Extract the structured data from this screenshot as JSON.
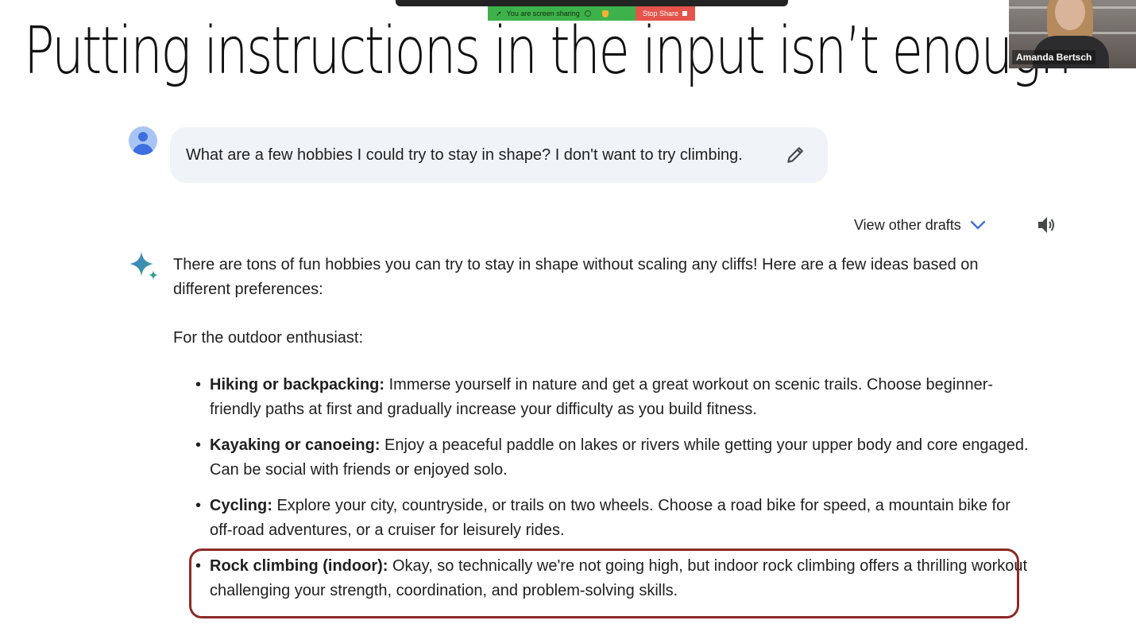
{
  "zoom": {
    "sharing_label": "You are screen sharing",
    "stop_label": "Stop Share",
    "participant_name": "Amanda Bertsch"
  },
  "slide": {
    "title": "Putting instructions in the input isn’t enough"
  },
  "chat": {
    "prompt": "What are a few hobbies I could try to stay in shape? I don't want to try climbing.",
    "view_drafts_label": "View other drafts",
    "intro": "There are tons of fun hobbies you can try to stay in shape without scaling any cliffs! Here are a few ideas based on different preferences:",
    "section_heading": "For the outdoor enthusiast:",
    "items": [
      {
        "title": "Hiking or backpacking:",
        "text": " Immerse yourself in nature and get a great workout on scenic trails. Choose beginner-friendly paths at first and gradually increase your difficulty as you build fitness."
      },
      {
        "title": "Kayaking or canoeing:",
        "text": " Enjoy a peaceful paddle on lakes or rivers while getting your upper body and core engaged. Can be social with friends or enjoyed solo."
      },
      {
        "title": "Cycling:",
        "text": " Explore your city, countryside, or trails on two wheels. Choose a road bike for speed, a mountain bike for off-road adventures, or a cruiser for leisurely rides."
      },
      {
        "title": "Rock climbing (indoor):",
        "text": " Okay, so technically we're not going high, but indoor rock climbing offers a thrilling workout challenging your strength, coordination, and problem-solving skills."
      }
    ]
  },
  "colors": {
    "highlight_border": "#8b2b28",
    "prompt_bg": "#f0f4f9",
    "accent_blue": "#3d6fe0"
  },
  "icons": [
    "edit-icon",
    "chevron-down-icon",
    "speaker-icon",
    "gemini-sparkle-icon",
    "user-avatar-icon"
  ]
}
